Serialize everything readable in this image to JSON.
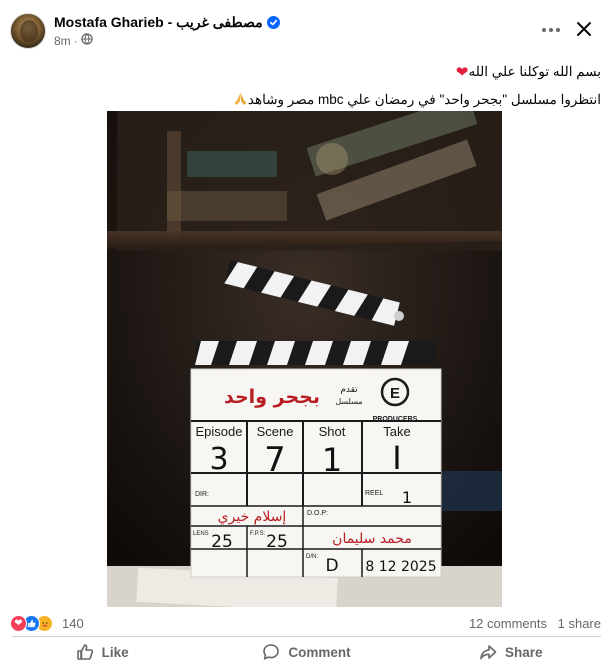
{
  "post": {
    "author": "Mostafa Gharieb - مصطفى غريب",
    "time": "8m",
    "separator": "·",
    "caption_line1": "بسم الله توكلنا علي الله",
    "caption_line2": "انتظروا مسلسل \"بجحر واحد\" في رمضان علي mbc مصر وشاهد"
  },
  "clapper": {
    "title": "بجحر واحد",
    "presents": "تقدم",
    "presents2": "مسلسل",
    "producers": "PRODUCERS",
    "episode_label": "Episode",
    "scene_label": "Scene",
    "shot_label": "Shot",
    "take_label": "Take",
    "episode": "3",
    "scene": "7",
    "shot": "1",
    "take": "I",
    "reel_label": "REEL",
    "reel": "1",
    "dir_label": "DIR:",
    "director": "إسلام خيري",
    "dop_label": "D.O.P:",
    "dop": "محمد سليمان",
    "lens_label": "LENS",
    "lens": "25",
    "fps_label": "F.P.S:",
    "fps": "25",
    "dn_label": "D/N:",
    "dn": "D",
    "date": "8 12 2025"
  },
  "stats": {
    "reactions": "140",
    "comments": "12 comments",
    "shares": "1 share"
  },
  "actions": {
    "like": "Like",
    "comment": "Comment",
    "share": "Share"
  },
  "colors": {
    "accent": "#0866ff",
    "love": "#f33e58",
    "meta": "#65676b",
    "title_red": "#b81d24"
  },
  "icons": [
    "verified-icon",
    "globe-icon",
    "more-icon",
    "close-icon",
    "heart-icon",
    "pray-icon",
    "love-reaction-icon",
    "like-reaction-icon",
    "care-reaction-icon",
    "like-icon",
    "comment-icon",
    "share-icon"
  ]
}
